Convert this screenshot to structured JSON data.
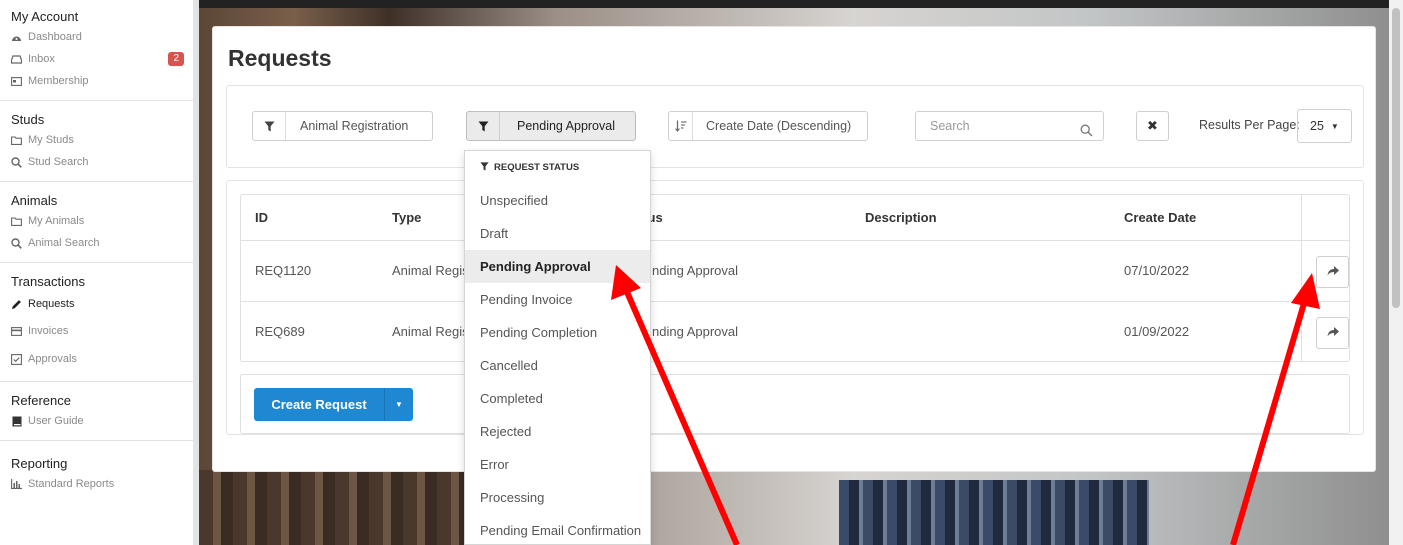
{
  "colors": {
    "accent": "#1e88d3",
    "badge": "#d9534f",
    "annotation": "#ff0000"
  },
  "sidebar": {
    "sections": [
      {
        "title": "My Account",
        "items": [
          {
            "label": "Dashboard",
            "icon": "dashboard-icon"
          },
          {
            "label": "Inbox",
            "icon": "inbox-icon",
            "badge": "2"
          },
          {
            "label": "Membership",
            "icon": "id-card-icon"
          }
        ]
      },
      {
        "title": "Studs",
        "items": [
          {
            "label": "My Studs",
            "icon": "folder-icon"
          },
          {
            "label": "Stud Search",
            "icon": "search-icon"
          }
        ]
      },
      {
        "title": "Animals",
        "items": [
          {
            "label": "My Animals",
            "icon": "folder-icon"
          },
          {
            "label": "Animal Search",
            "icon": "search-icon"
          }
        ]
      },
      {
        "title": "Transactions",
        "items": [
          {
            "label": "Requests",
            "icon": "pencil-icon",
            "active": true
          },
          {
            "label": "Invoices",
            "icon": "credit-card-icon"
          },
          {
            "label": "Approvals",
            "icon": "checkbox-icon"
          }
        ]
      },
      {
        "title": "Reference",
        "items": [
          {
            "label": "User Guide",
            "icon": "book-icon"
          }
        ]
      },
      {
        "title": "Reporting",
        "items": [
          {
            "label": "Standard Reports",
            "icon": "bar-chart-icon"
          }
        ]
      }
    ]
  },
  "page": {
    "title": "Requests"
  },
  "filters": {
    "type_filter": "Animal Registration",
    "status_filter": "Pending Approval",
    "sort": "Create Date (Descending)",
    "search_placeholder": "Search",
    "results_per_page_label": "Results Per Page:",
    "results_per_page_value": "25"
  },
  "table": {
    "columns": [
      "ID",
      "Type",
      "Status",
      "Description",
      "Create Date"
    ],
    "rows": [
      {
        "id": "REQ1120",
        "type": "Animal Regis",
        "status": "nding Approval",
        "description": "",
        "create_date": "07/10/2022"
      },
      {
        "id": "REQ689",
        "type": "Animal Regis",
        "status": "nding Approval",
        "description": "",
        "create_date": "01/09/2022"
      }
    ]
  },
  "create_button": {
    "label": "Create Request"
  },
  "status_dropdown": {
    "header": "REQUEST STATUS",
    "selected": "Pending Approval",
    "options": [
      "Unspecified",
      "Draft",
      "Pending Approval",
      "Pending Invoice",
      "Pending Completion",
      "Cancelled",
      "Completed",
      "Rejected",
      "Error",
      "Processing",
      "Pending Email Confirmation"
    ]
  }
}
